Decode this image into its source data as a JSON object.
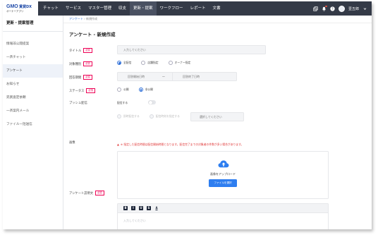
{
  "header": {
    "logo_gmo": "GMO",
    "logo_brand": "賃貸DX",
    "logo_sub": "オーナーアプリ",
    "nav": [
      "チャット",
      "サービス",
      "マスター管理",
      "収支",
      "更新・提案",
      "ワークフロー",
      "レポート",
      "文書"
    ],
    "nav_active": "更新・提案",
    "user_name": "壹五郎"
  },
  "sidebar": {
    "title": "更新・提案管理",
    "items": [
      "情報非公開提案",
      "一斉チャット",
      "アンケート",
      "お知らせ",
      "売買査定依頼",
      "一斉案内メール",
      "ファイル一括送信"
    ],
    "active": "アンケート"
  },
  "breadcrumb": {
    "parent": "アンケート",
    "sep": "›",
    "current": "新規作成"
  },
  "page": {
    "title": "アンケート - 新規作成"
  },
  "form": {
    "title_label": "タイトル",
    "title_placeholder": "入力してください",
    "required_badge": "必須",
    "target_label": "対象種別",
    "target_options": [
      "全配信",
      "店舗指定",
      "オーナー指定"
    ],
    "period_label": "回答期間",
    "period_start_placeholder": "回答開始日時",
    "period_sep": "〜",
    "period_end_placeholder": "回答終了日時",
    "status_label": "ステータス",
    "status_options": [
      "公開",
      "非公開"
    ],
    "push_label": "プッシュ配信",
    "push_toggle_label": "配信する",
    "push_options": [
      "即時配信する",
      "配信時刻を指定する"
    ],
    "push_datetime_placeholder": "選択してください",
    "warning": "※ 指定した配信時間は配信開始時間となります。配信完了までの対象者の件数が多い場合があります。",
    "image_label": "画像",
    "upload_text": "画像をアップロード",
    "file_button": "ファイルを選択",
    "body_label": "アンケート説明文",
    "editor_tools": [
      "B",
      "I",
      "U",
      "S",
      "A"
    ],
    "editor_placeholder": "入力してください"
  }
}
